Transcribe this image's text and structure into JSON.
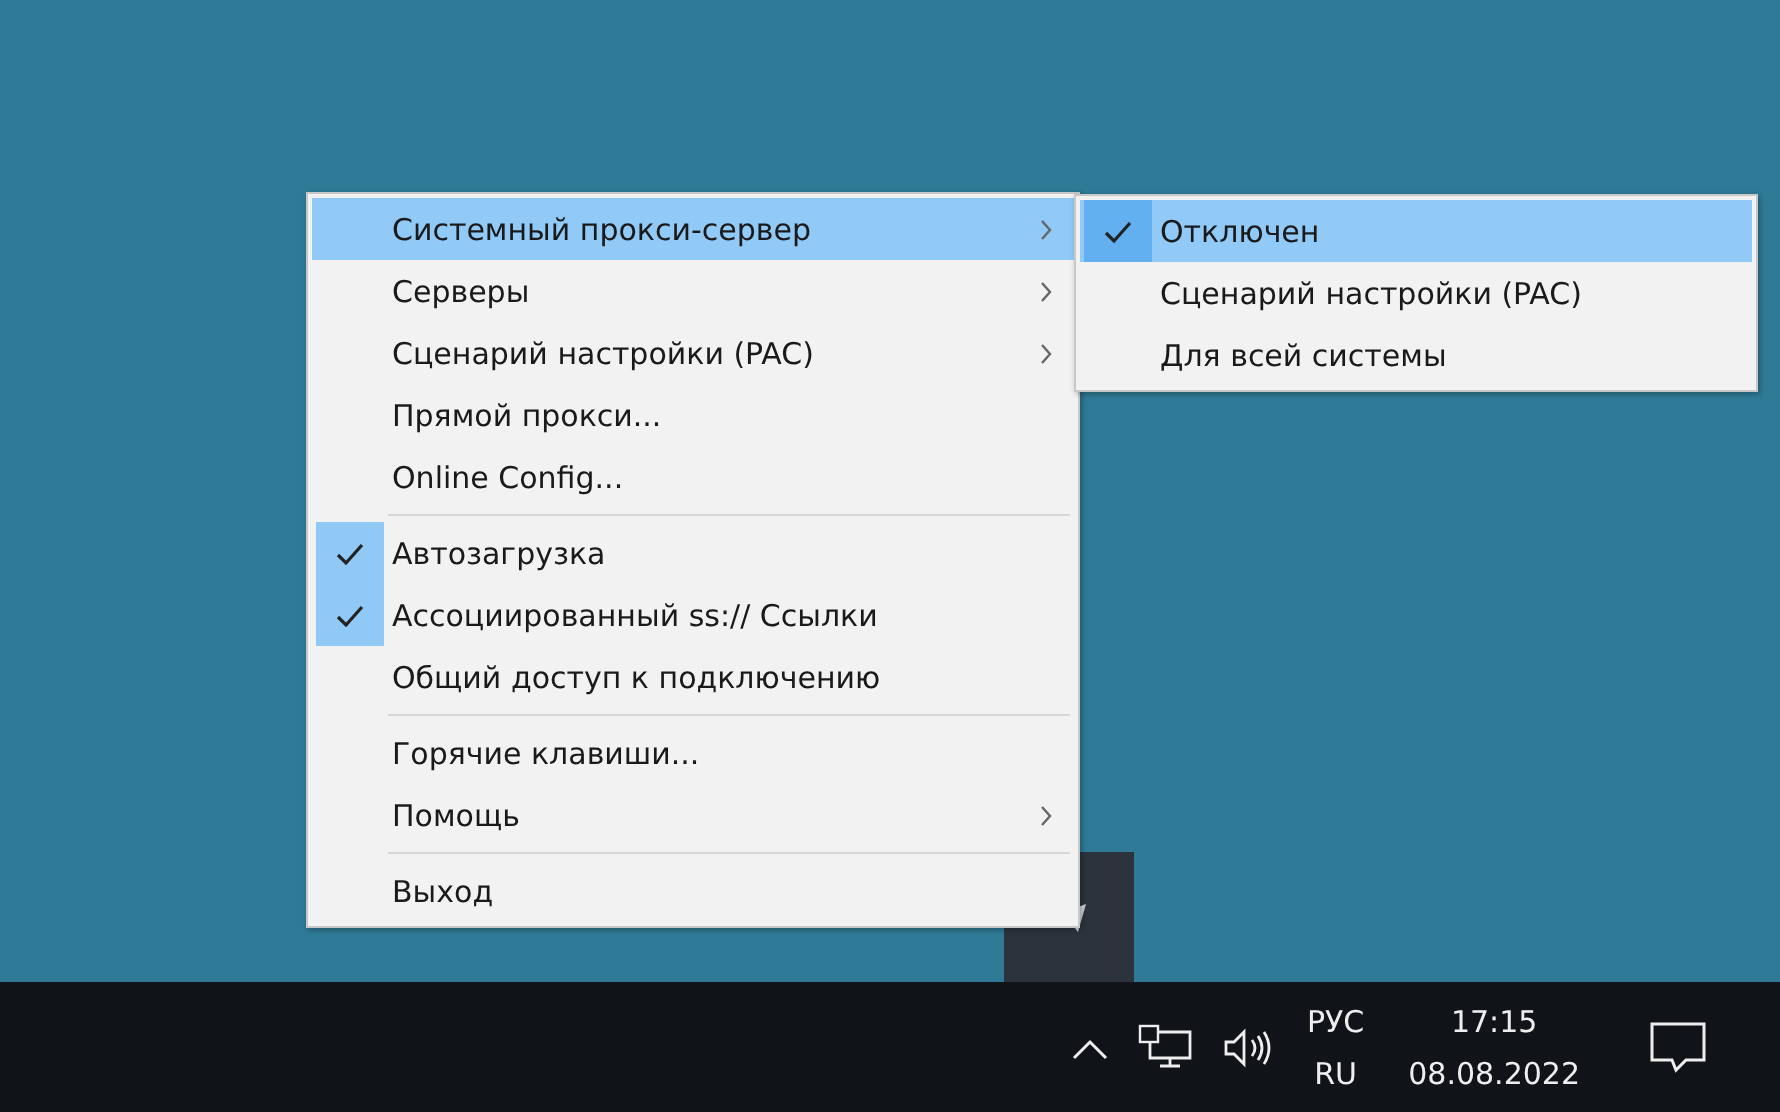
{
  "menu": {
    "items": [
      {
        "kind": "item",
        "label": "Системный прокси-сервер",
        "checked": false,
        "submenu": true,
        "selected": true
      },
      {
        "kind": "item",
        "label": "Серверы",
        "checked": false,
        "submenu": true,
        "selected": false
      },
      {
        "kind": "item",
        "label": "Сценарий настройки (PAC)",
        "checked": false,
        "submenu": true,
        "selected": false
      },
      {
        "kind": "item",
        "label": "Прямой прокси...",
        "checked": false,
        "submenu": false,
        "selected": false
      },
      {
        "kind": "item",
        "label": "Online Config...",
        "checked": false,
        "submenu": false,
        "selected": false
      },
      {
        "kind": "separator"
      },
      {
        "kind": "item",
        "label": "Автозагрузка",
        "checked": true,
        "submenu": false,
        "selected": false
      },
      {
        "kind": "item",
        "label": "Ассоциированный ss:// Ссылки",
        "checked": true,
        "submenu": false,
        "selected": false
      },
      {
        "kind": "item",
        "label": "Общий доступ к подключению",
        "checked": false,
        "submenu": false,
        "selected": false
      },
      {
        "kind": "separator"
      },
      {
        "kind": "item",
        "label": "Горячие клавиши...",
        "checked": false,
        "submenu": false,
        "selected": false
      },
      {
        "kind": "item",
        "label": "Помощь",
        "checked": false,
        "submenu": true,
        "selected": false
      },
      {
        "kind": "separator"
      },
      {
        "kind": "item",
        "label": "Выход",
        "checked": false,
        "submenu": false,
        "selected": false
      }
    ]
  },
  "submenu": {
    "items": [
      {
        "label": "Отключен",
        "checked": true,
        "selected": true
      },
      {
        "label": "Сценарий настройки (PAC)",
        "checked": false,
        "selected": false
      },
      {
        "label": "Для всей системы",
        "checked": false,
        "selected": false
      }
    ]
  },
  "taskbar": {
    "language": "РУС",
    "layout": "RU",
    "time": "17:15",
    "date": "08.08.2022"
  }
}
